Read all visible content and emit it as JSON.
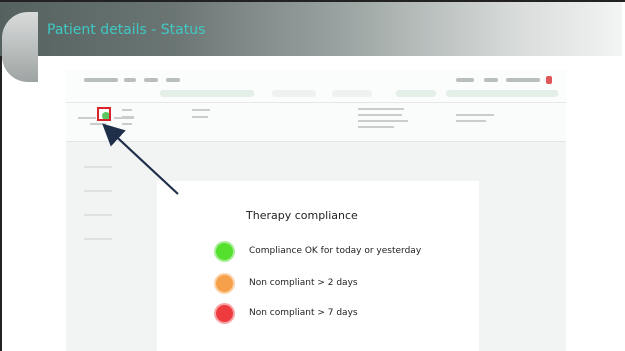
{
  "slide": {
    "title": "Patient details - Status"
  },
  "popup": {
    "title": "Therapy compliance",
    "legend": [
      {
        "label": "Compliance OK for today or yesterday",
        "color": "#56e02e",
        "icon": "green-circle-icon"
      },
      {
        "label": "Non compliant > 2 days",
        "color": "#f6a04b",
        "icon": "orange-circle-icon"
      },
      {
        "label": "Non compliant > 7 days",
        "color": "#ee3b3d",
        "icon": "red-circle-icon"
      }
    ]
  },
  "colors": {
    "title": "#3fc9c4",
    "status_green": "#34b83a",
    "highlight_box": "#d8232a",
    "arrow": "#1f2f4a"
  }
}
